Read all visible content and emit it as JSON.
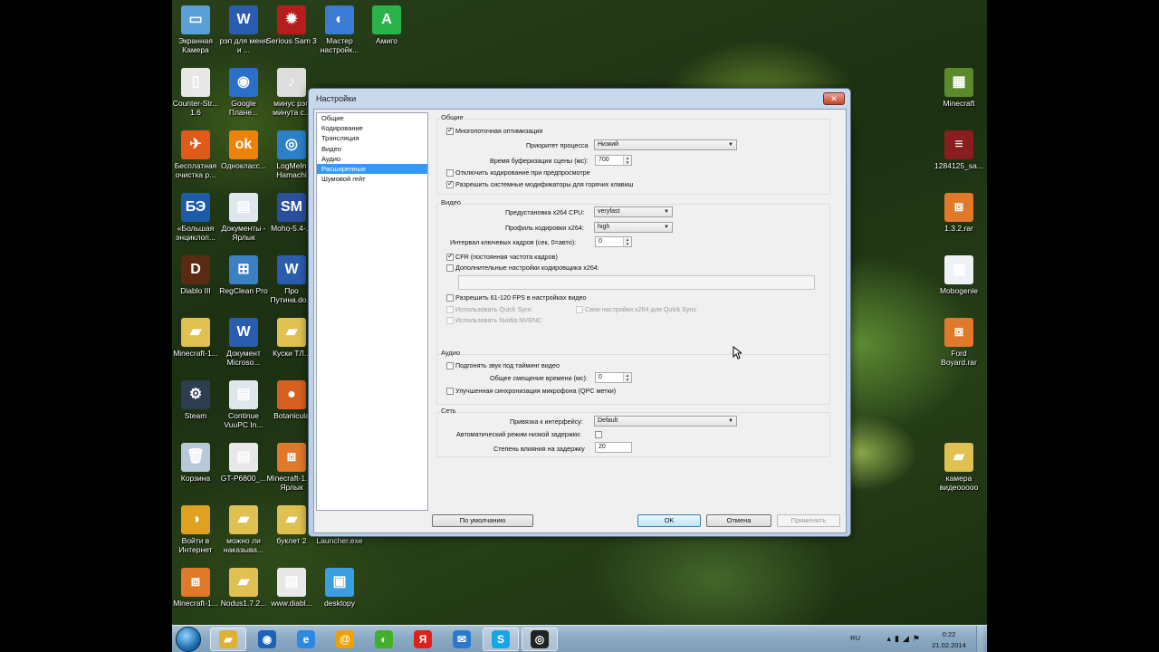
{
  "desktop": {
    "icons": [
      {
        "label": "Экранная Камера",
        "color": "#5aa0d8",
        "glyph": "▭"
      },
      {
        "label": "рэп для меня и ...",
        "color": "#2a5cb0",
        "glyph": "W"
      },
      {
        "label": "Serious Sam 3",
        "color": "#b81d1d",
        "glyph": "✹"
      },
      {
        "label": "Мастер настройк...",
        "color": "#3b7bd4",
        "glyph": "◐"
      },
      {
        "label": "Амиго",
        "color": "#29b34a",
        "glyph": "A"
      },
      {
        "label": "Counter-Str... 1.6",
        "color": "#e8e8e8",
        "glyph": "▯"
      },
      {
        "label": "Google Плане...",
        "color": "#2a6fc8",
        "glyph": "◉"
      },
      {
        "label": "минус рэп минута с...",
        "color": "#dddddd",
        "glyph": "♪"
      },
      {
        "label": "Бесплатная очистка р...",
        "color": "#e05a1a",
        "glyph": "✈"
      },
      {
        "label": "Однокласс...",
        "color": "#ee8208",
        "glyph": "ok"
      },
      {
        "label": "LogMeIn Hamachi",
        "color": "#2b80c8",
        "glyph": "◎"
      },
      {
        "label": "«Большая энциклоп...",
        "color": "#1d5aa8",
        "glyph": "БЭ"
      },
      {
        "label": "Документы - Ярлык",
        "color": "#dfe6ee",
        "glyph": "▤"
      },
      {
        "label": "Moho-5.4-...",
        "color": "#2a4f9c",
        "glyph": "SM"
      },
      {
        "label": "Diablo III",
        "color": "#5a2a12",
        "glyph": "D"
      },
      {
        "label": "RegClean Pro",
        "color": "#3b7fc4",
        "glyph": "⊞"
      },
      {
        "label": "Про Путина.do...",
        "color": "#2a5cb0",
        "glyph": "W"
      },
      {
        "label": "Minecraft-1...",
        "color": "#e0c050",
        "glyph": "▰"
      },
      {
        "label": "Документ Microso...",
        "color": "#2a5cb0",
        "glyph": "W"
      },
      {
        "label": "Куски ТЛ...",
        "color": "#e0c050",
        "glyph": "▰"
      },
      {
        "label": "Steam",
        "color": "#2c3e50",
        "glyph": "⚙"
      },
      {
        "label": "Continue VuuPC In...",
        "color": "#dfe6ee",
        "glyph": "▤"
      },
      {
        "label": "Botanicula",
        "color": "#d8601e",
        "glyph": "●"
      },
      {
        "label": "Корзина",
        "color": "#b7c9d9",
        "glyph": "🗑"
      },
      {
        "label": "GT-P6800_...",
        "color": "#e8e8e8",
        "glyph": "▤"
      },
      {
        "label": "Minecraft-1... - Ярлык",
        "color": "#e07a2a",
        "glyph": "⧈"
      },
      {
        "label": "Войти в Интернет",
        "color": "#e0a020",
        "glyph": "◑"
      },
      {
        "label": "можно ли наказыва...",
        "color": "#e0c050",
        "glyph": "▰"
      },
      {
        "label": "буклет 2",
        "color": "#e0c050",
        "glyph": "▰"
      },
      {
        "label": "Launcher.exe",
        "color": "#cfd8e2",
        "glyph": "▭"
      },
      {
        "label": "Minecraft-1...",
        "color": "#e07a2a",
        "glyph": "⧈"
      },
      {
        "label": "Nodus1.7.2...",
        "color": "#e0c050",
        "glyph": "▰"
      },
      {
        "label": "www.diabl...",
        "color": "#e8e8e8",
        "glyph": "▤"
      },
      {
        "label": "desktopy",
        "color": "#3a9ee0",
        "glyph": "▣"
      },
      {
        "label": "Minecraft",
        "color": "#5b8a2c",
        "glyph": "▦"
      },
      {
        "label": "1284125_sa...",
        "color": "#8a1d1d",
        "glyph": "≡"
      },
      {
        "label": "1.3.2.rar",
        "color": "#e07a2a",
        "glyph": "⧈"
      },
      {
        "label": "Mobogenie",
        "color": "#eef2f6",
        "glyph": "▦"
      },
      {
        "label": "Ford Boyard.rar",
        "color": "#e07a2a",
        "glyph": "⧈"
      },
      {
        "label": "камера видеоoooo",
        "color": "#e0c050",
        "glyph": "▰"
      }
    ]
  },
  "dialog": {
    "title": "Настройки",
    "close": "✕",
    "nav": [
      "Общие",
      "Кодирование",
      "Трансляция",
      "Видео",
      "Аудио",
      "Расширенные",
      "Шумовой гейт"
    ],
    "nav_selected": "Расширенные",
    "general": {
      "section": "Общие",
      "multithread": "Многопоточная оптимизация",
      "priority_label": "Приоритет процесса",
      "priority_value": "Низкий",
      "buffer_label": "Время буферизации сцены (мс):",
      "buffer_value": "700",
      "disable_preview_encoding": "Отключить кодирование при предпросмотре",
      "allow_hotkey_modifiers": "Разрешить системные модификаторы для горячих клавиш"
    },
    "video": {
      "section": "Видео",
      "preset_label": "Предустановка x264 CPU:",
      "preset_value": "veryfast",
      "profile_label": "Профиль кодировки x264:",
      "profile_value": "high",
      "keyframe_label": "Интервал ключевых кадров (сек, 0=авто):",
      "keyframe_value": "0",
      "cfr": "CFR (постоянная частота кадров)",
      "extra_x264": "Дополнительные настройки кодировщика x264:",
      "allow_61_120": "Разрешить 61-120 FPS в настройках видео",
      "quick_sync": "Использовать Quick Sync",
      "own_x264_quicksync": "Свои настройки x264 для Quick Sync",
      "nvenc": "Использовать Nvidia NVENC"
    },
    "audio": {
      "section": "Аудио",
      "sync_to_video": "Подгонять звук под тайминг видео",
      "offset_label": "Общее смещение времени (мс):",
      "offset_value": "0",
      "mic_sync": "Улучшенная синхронизация микрофона (QPC метки)"
    },
    "network": {
      "section": "Сеть",
      "bind_label": "Привязка к интерфейсу:",
      "bind_value": "Default",
      "low_latency_label": "Автоматический режим низкой задержки:",
      "latency_factor_label": "Степень влияния на задержку",
      "latency_factor_value": "20"
    },
    "buttons": {
      "defaults": "По умолчанию",
      "ok": "OK",
      "cancel": "Отмена",
      "apply": "Применить"
    }
  },
  "taskbar": {
    "lang": "RU",
    "time": "0:22",
    "date": "21.02.2014",
    "apps": [
      {
        "name": "explorer",
        "glyph": "▰",
        "color": "#e0b030"
      },
      {
        "name": "media-player",
        "glyph": "◉",
        "color": "#1d63b5"
      },
      {
        "name": "internet-explorer",
        "glyph": "e",
        "color": "#2b8ae0"
      },
      {
        "name": "mail-agent",
        "glyph": "@",
        "color": "#f0a000"
      },
      {
        "name": "amigo",
        "glyph": "◐",
        "color": "#42b02a"
      },
      {
        "name": "yandex",
        "glyph": "Я",
        "color": "#e0201a"
      },
      {
        "name": "mail",
        "glyph": "✉",
        "color": "#2b7ad0"
      },
      {
        "name": "skype",
        "glyph": "S",
        "color": "#16a6e6"
      },
      {
        "name": "obs",
        "glyph": "◎",
        "color": "#222222"
      }
    ]
  }
}
